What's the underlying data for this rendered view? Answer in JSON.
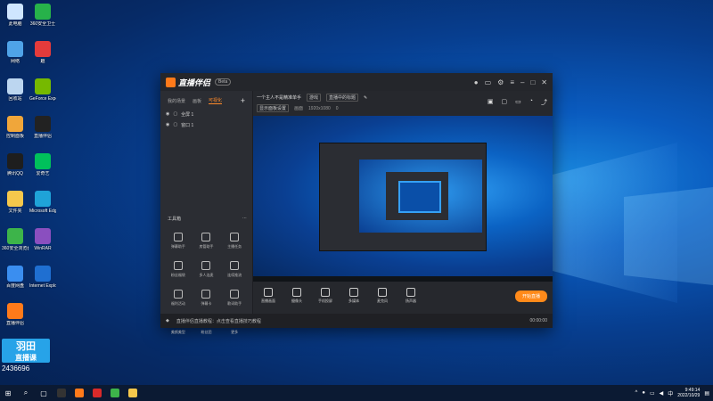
{
  "desktop_icons": [
    {
      "label": "此电脑",
      "color": "#cfe6ff"
    },
    {
      "label": "360安全卫士",
      "color": "#27b24a"
    },
    {
      "label": "网络",
      "color": "#4fa3e8"
    },
    {
      "label": "趣",
      "color": "#e43b3b"
    },
    {
      "label": "回收站",
      "color": "#bcd6f0"
    },
    {
      "label": "GeForce Experience",
      "color": "#76b900"
    },
    {
      "label": "控制面板",
      "color": "#f0a63a"
    },
    {
      "label": "直播伴侣",
      "color": "#222222"
    },
    {
      "label": "腾讯QQ",
      "color": "#1e1e1e"
    },
    {
      "label": "爱奇艺",
      "color": "#00c15b"
    },
    {
      "label": "文件夹",
      "color": "#f6c84c"
    },
    {
      "label": "Microsoft Edge",
      "color": "#1fa3d8"
    },
    {
      "label": "360安全浏览器",
      "color": "#3db44a"
    },
    {
      "label": "WinRAR",
      "color": "#8a4fbf"
    },
    {
      "label": "百度网盘",
      "color": "#3a8ef0"
    },
    {
      "label": "Internet Explorer",
      "color": "#1f6fd1"
    },
    {
      "label": "直播伴侣",
      "color": "#ff7a1a"
    }
  ],
  "app": {
    "title": "直播伴侣",
    "version": "Beta",
    "tabs": [
      "我的场景",
      "画板",
      "可视化"
    ],
    "add": "+",
    "scenes": [
      "全屏 1",
      "窗口 1"
    ],
    "header_title": "一个主人不是精准单手",
    "header_chip1": "游戏",
    "header_chip2": "直播中的标题",
    "row2_chip": "显示面板设置",
    "row2_a": "画面",
    "row2_b": "1920x1080",
    "row2_c": "0",
    "tools_label": "工具箱",
    "tools": [
      "弹幕助手",
      "房管助手",
      "主播任务",
      "粉丝福袋",
      "多人连麦",
      "连续推流",
      "福利活动",
      "弹幕卡",
      "歌词助手",
      "美颜美型",
      "粉丝团",
      "更多"
    ],
    "bottom_tools": [
      "直播画面",
      "摄像头",
      "手机投屏",
      "多媒体",
      "麦克风",
      "扬声器"
    ],
    "live_button": "开始直播",
    "status_text": "直播伴侣直播教程：点击查看直播技巧教程",
    "timer": "00:00:00"
  },
  "taskbar": {
    "time": "9:49:14",
    "date": "2022/10/29",
    "lang": "中"
  },
  "watermark": {
    "box_text": "羽田",
    "box_text2": "直播课",
    "code": "2436696"
  }
}
